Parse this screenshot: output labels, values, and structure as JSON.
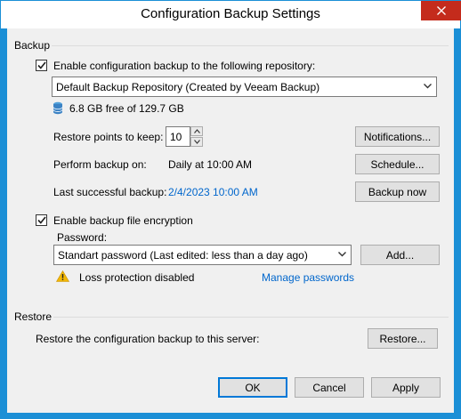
{
  "window": {
    "title": "Configuration Backup Settings"
  },
  "backup": {
    "group_label": "Backup",
    "enable_label": "Enable configuration backup to the following repository:",
    "enable_checked": true,
    "repository_selected": "Default Backup Repository (Created by Veeam Backup)",
    "free_space": "6.8 GB free of 129.7 GB",
    "restore_points_label": "Restore points to keep:",
    "restore_points_value": "10",
    "notifications_button": "Notifications...",
    "perform_label": "Perform backup on:",
    "perform_value": "Daily at 10:00 AM",
    "schedule_button": "Schedule...",
    "last_label": "Last successful backup:",
    "last_value": "2/4/2023 10:00 AM",
    "backup_now_button": "Backup now",
    "encryption_label": "Enable backup file encryption",
    "encryption_checked": true,
    "password_label": "Password:",
    "password_selected": "Standart password (Last edited: less than a day ago)",
    "add_button": "Add...",
    "warning_text": "Loss protection disabled",
    "manage_link": "Manage passwords"
  },
  "restore": {
    "group_label": "Restore",
    "description": "Restore the configuration backup to this server:",
    "restore_button": "Restore..."
  },
  "footer": {
    "ok_button": "OK",
    "cancel_button": "Cancel",
    "apply_button": "Apply"
  },
  "colors": {
    "accent": "#1b8fd6",
    "link": "#0066cc",
    "close": "#c42b1c",
    "warning": "#f2b705"
  },
  "icons": {
    "close": "close-icon",
    "checkbox": "checkmark-icon",
    "dropdown": "chevron-down-icon",
    "database": "database-icon",
    "warning": "warning-icon",
    "spin_up": "spin-up-icon",
    "spin_down": "spin-down-icon"
  }
}
